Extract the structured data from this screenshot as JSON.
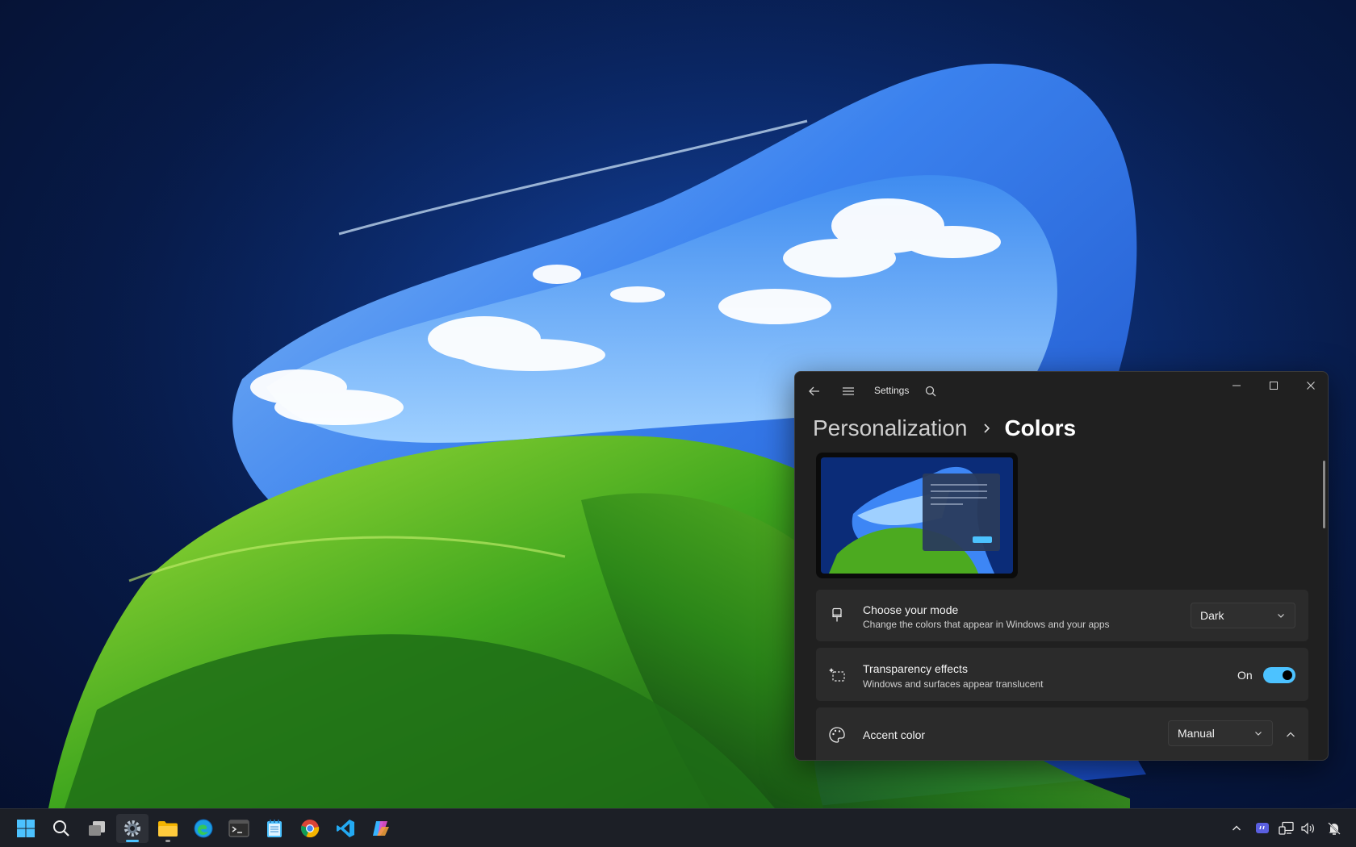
{
  "window": {
    "title": "Settings",
    "breadcrumb": {
      "parent": "Personalization",
      "current": "Colors"
    }
  },
  "settings": [
    {
      "icon": "brush-icon",
      "title": "Choose your mode",
      "description": "Change the colors that appear in Windows and your apps",
      "control": "dropdown",
      "value": "Dark"
    },
    {
      "icon": "transparency-icon",
      "title": "Transparency effects",
      "description": "Windows and surfaces appear translucent",
      "control": "toggle",
      "state_label": "On",
      "state": true
    },
    {
      "icon": "palette-icon",
      "title": "Accent color",
      "control": "dropdown",
      "value": "Manual",
      "expanded": true
    }
  ],
  "colors": {
    "accent": "#4cc2ff",
    "window_bg": "#202020",
    "card_bg": "#2b2b2b",
    "taskbar_bg": "#1c1f26"
  },
  "taskbar": {
    "apps": [
      {
        "name": "start",
        "icon": "windows-logo-icon"
      },
      {
        "name": "search",
        "icon": "search-icon"
      },
      {
        "name": "task-view",
        "icon": "task-view-icon"
      },
      {
        "name": "settings",
        "icon": "gear-icon",
        "active": true
      },
      {
        "name": "file-explorer",
        "icon": "folder-icon",
        "running": true
      },
      {
        "name": "edge",
        "icon": "edge-icon"
      },
      {
        "name": "terminal",
        "icon": "terminal-icon"
      },
      {
        "name": "notepad",
        "icon": "notepad-icon"
      },
      {
        "name": "chrome",
        "icon": "chrome-icon"
      },
      {
        "name": "visual-studio-code",
        "icon": "vscode-icon"
      },
      {
        "name": "copilot",
        "icon": "copilot-icon"
      }
    ],
    "tray": [
      "chevron-up-icon",
      "app-tray-icon",
      "network-icon",
      "volume-icon",
      "notification-icon"
    ]
  }
}
